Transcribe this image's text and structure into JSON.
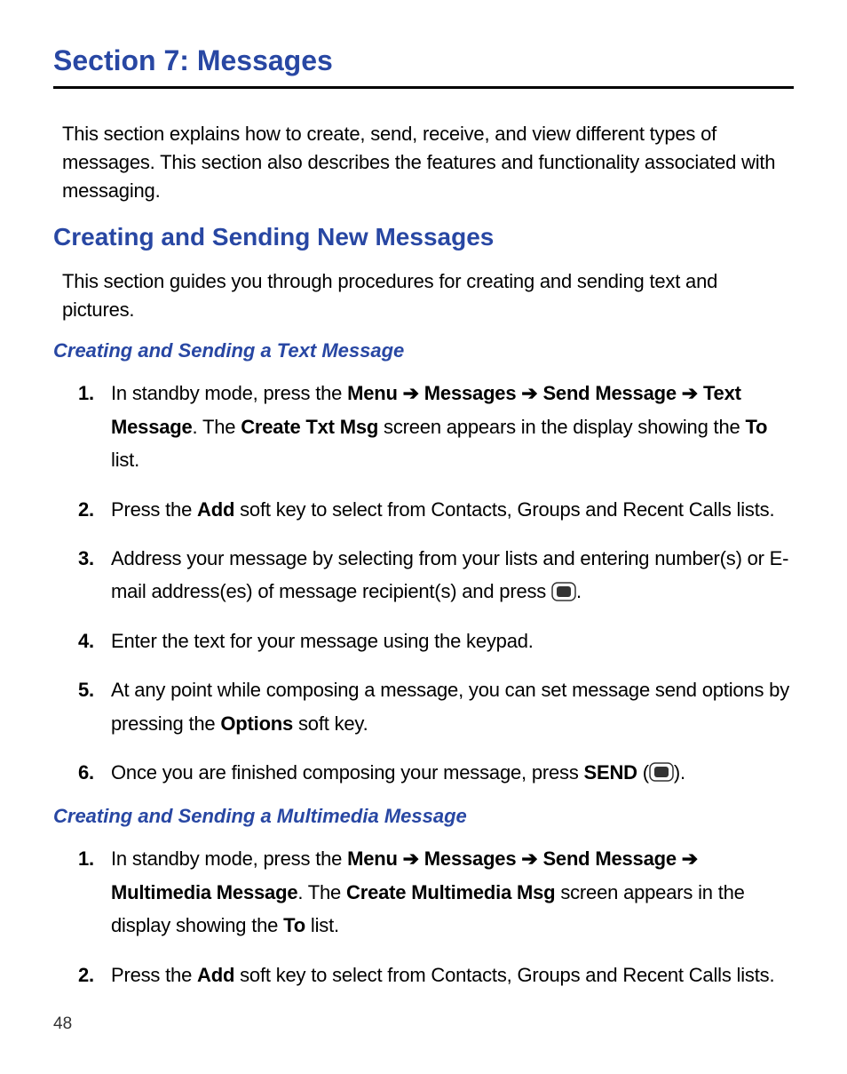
{
  "section": {
    "title": "Section 7: Messages",
    "intro": "This section explains how to create, send, receive, and view different types of messages. This section also describes the features and functionality associated with messaging."
  },
  "subsection1": {
    "title": "Creating and Sending New Messages",
    "intro": "This section guides you through procedures for creating and sending text and pictures."
  },
  "textMessage": {
    "title": "Creating and Sending a Text Message",
    "steps": {
      "n1": "1.",
      "s1_p1": "In standby mode, press the ",
      "s1_menu": "Menu",
      "s1_arrow1": " ➔ ",
      "s1_messages": "Messages",
      "s1_arrow2": " ➔ ",
      "s1_sendmsg": "Send Message",
      "s1_arrow3": " ➔ ",
      "s1_textmsg": "Text Message",
      "s1_p2": ". The ",
      "s1_createtxt": "Create Txt Msg",
      "s1_p3": " screen appears in the display showing the ",
      "s1_to": "To",
      "s1_p4": " list.",
      "n2": "2.",
      "s2_p1": "Press the ",
      "s2_add": "Add",
      "s2_p2": " soft key to select from Contacts, Groups and Recent Calls lists.",
      "n3": "3.",
      "s3_p1": "Address your message by selecting from your lists and entering number(s) or E-mail address(es) of message recipient(s) and press ",
      "s3_p2": ".",
      "n4": "4.",
      "s4": "Enter the text for your message using the keypad.",
      "n5": "5.",
      "s5_p1": "At any point while composing a message, you can set message send options by pressing the ",
      "s5_options": "Options",
      "s5_p2": " soft key.",
      "n6": "6.",
      "s6_p1": "Once you are finished composing your message, press ",
      "s6_send": "SEND",
      "s6_p2": " (",
      "s6_p3": ")."
    }
  },
  "multimediaMessage": {
    "title": "Creating and Sending a Multimedia Message",
    "steps": {
      "n1": "1.",
      "s1_p1": "In standby mode, press the ",
      "s1_menu": "Menu",
      "s1_arrow1": " ➔ ",
      "s1_messages": "Messages",
      "s1_arrow2": " ➔ ",
      "s1_sendmsg": "Send Message",
      "s1_arrow3": " ➔ ",
      "s1_mmmsg": "Multimedia Message",
      "s1_p2": ". The ",
      "s1_createmm": "Create Multimedia Msg",
      "s1_p3": " screen appears in the display showing the ",
      "s1_to": "To",
      "s1_p4": " list.",
      "n2": "2.",
      "s2_p1": "Press the ",
      "s2_add": "Add",
      "s2_p2": " soft key to select from Contacts, Groups and Recent Calls lists."
    }
  },
  "pageNumber": "48"
}
